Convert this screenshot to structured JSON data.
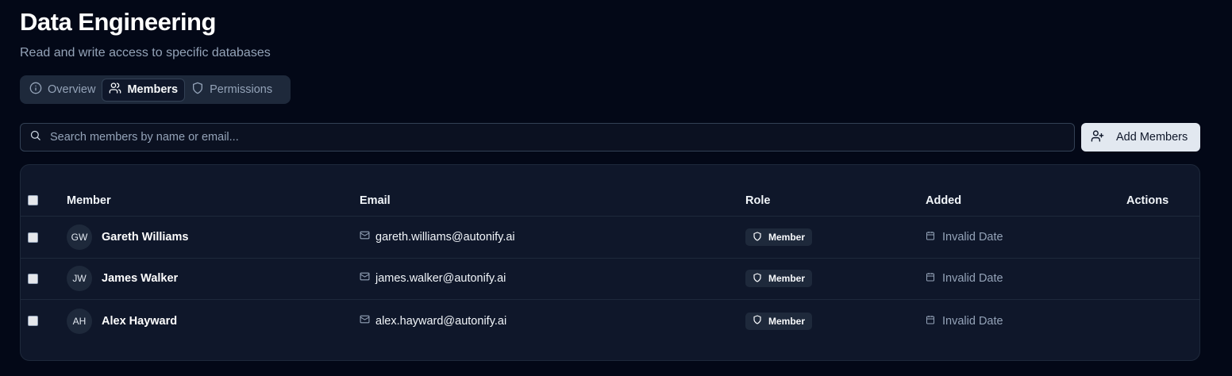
{
  "page": {
    "title": "Data Engineering",
    "subtitle": "Read and write access to specific databases"
  },
  "tabs": [
    {
      "label": "Overview",
      "icon": "info-icon",
      "active": false
    },
    {
      "label": "Members",
      "icon": "users-icon",
      "active": true
    },
    {
      "label": "Permissions",
      "icon": "shield-icon",
      "active": false
    }
  ],
  "search": {
    "placeholder": "Search members by name or email...",
    "value": ""
  },
  "add_button": {
    "label": "Add Members",
    "icon": "user-plus-icon"
  },
  "table": {
    "columns": [
      "Member",
      "Email",
      "Role",
      "Added",
      "Actions"
    ],
    "rows": [
      {
        "initials": "GW",
        "name": "Gareth Williams",
        "email": "gareth.williams@autonify.ai",
        "role": "Member",
        "added": "Invalid Date"
      },
      {
        "initials": "JW",
        "name": "James Walker",
        "email": "james.walker@autonify.ai",
        "role": "Member",
        "added": "Invalid Date"
      },
      {
        "initials": "AH",
        "name": "Alex Hayward",
        "email": "alex.hayward@autonify.ai",
        "role": "Member",
        "added": "Invalid Date"
      }
    ]
  },
  "colors": {
    "background": "#030817",
    "surface": "#0f172a",
    "border": "#1e293b",
    "muted_text": "#94a3b8",
    "button_bg": "#e2e8f0"
  }
}
